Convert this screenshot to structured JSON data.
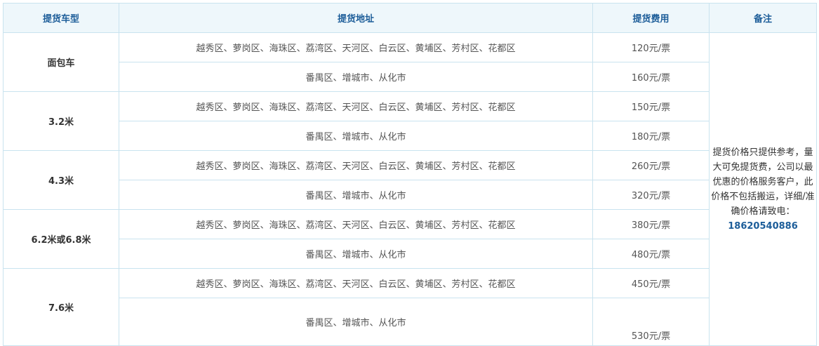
{
  "headers": {
    "vehicle": "提货车型",
    "address": "提货地址",
    "fee": "提货费用",
    "notes": "备注"
  },
  "rows": [
    {
      "vehicle": "面包车",
      "entries": [
        {
          "address": "越秀区、萝岗区、海珠区、荔湾区、天河区、白云区、黄埔区、芳村区、花都区",
          "fee": "120元/票"
        },
        {
          "address": "番禺区、增城市、从化市",
          "fee": "160元/票"
        }
      ]
    },
    {
      "vehicle": "3.2米",
      "entries": [
        {
          "address": "越秀区、萝岗区、海珠区、荔湾区、天河区、白云区、黄埔区、芳村区、花都区",
          "fee": "150元/票"
        },
        {
          "address": "番禺区、增城市、从化市",
          "fee": "180元/票"
        }
      ]
    },
    {
      "vehicle": "4.3米",
      "entries": [
        {
          "address": "越秀区、萝岗区、海珠区、荔湾区、天河区、白云区、黄埔区、芳村区、花都区",
          "fee": "260元/票"
        },
        {
          "address": "番禺区、增城市、从化市",
          "fee": "320元/票"
        }
      ]
    },
    {
      "vehicle": "6.2米或6.8米",
      "entries": [
        {
          "address": "越秀区、萝岗区、海珠区、荔湾区、天河区、白云区、黄埔区、芳村区、花都区",
          "fee": "380元/票"
        },
        {
          "address": "番禺区、增城市、从化市",
          "fee": "480元/票"
        }
      ]
    },
    {
      "vehicle": "7.6米",
      "entries": [
        {
          "address": "越秀区、萝岗区、海珠区、荔湾区、天河区、白云区、黄埔区、芳村区、花都区",
          "fee": "450元/票"
        },
        {
          "address": "番禺区、增城市、从化市",
          "fee": "530元/票"
        }
      ]
    }
  ],
  "notes": {
    "text": "提货价格只提供参考，量大可免提货费，公司以最优惠的价格服务客户，此价格不包括搬运，详细/准确价格请致电：",
    "phone": "18620540886"
  },
  "colors": {
    "border": "#c9e3ef",
    "header_bg": "#eef7fb",
    "header_text": "#1c5d99",
    "body_text": "#555555",
    "phone": "#1c5d99"
  }
}
